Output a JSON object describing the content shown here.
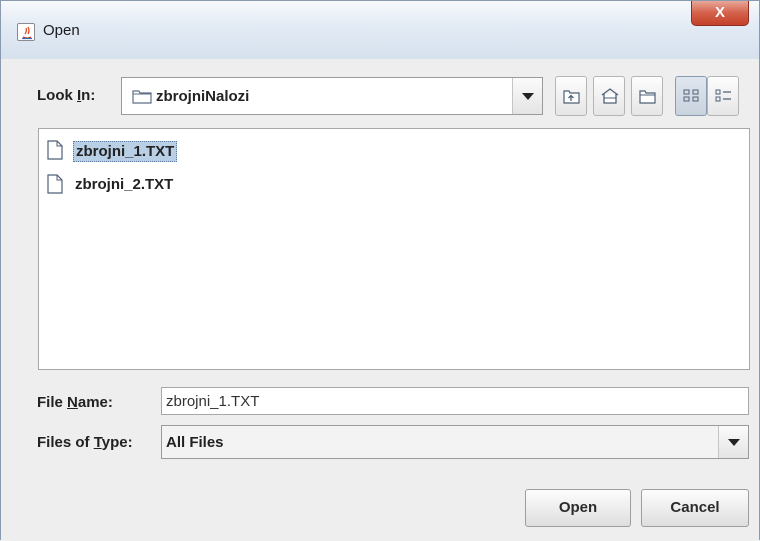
{
  "window": {
    "title": "Open",
    "close_glyph": "X"
  },
  "look_in": {
    "label_pre": "Look ",
    "label_mnemonic": "I",
    "label_post": "n:",
    "value": "zbrojniNalozi"
  },
  "toolbar": {
    "icons": [
      "up-folder-icon",
      "home-icon",
      "new-folder-icon",
      "list-view-icon",
      "details-view-icon"
    ]
  },
  "files": [
    {
      "name": "zbrojni_1.TXT",
      "selected": true
    },
    {
      "name": "zbrojni_2.TXT",
      "selected": false
    }
  ],
  "file_name": {
    "label_pre": "File ",
    "label_mnemonic": "N",
    "label_post": "ame:",
    "value": "zbrojni_1.TXT"
  },
  "file_type": {
    "label_pre": "Files of ",
    "label_mnemonic": "T",
    "label_post": "ype:",
    "value": "All Files"
  },
  "buttons": {
    "open": "Open",
    "cancel": "Cancel"
  }
}
